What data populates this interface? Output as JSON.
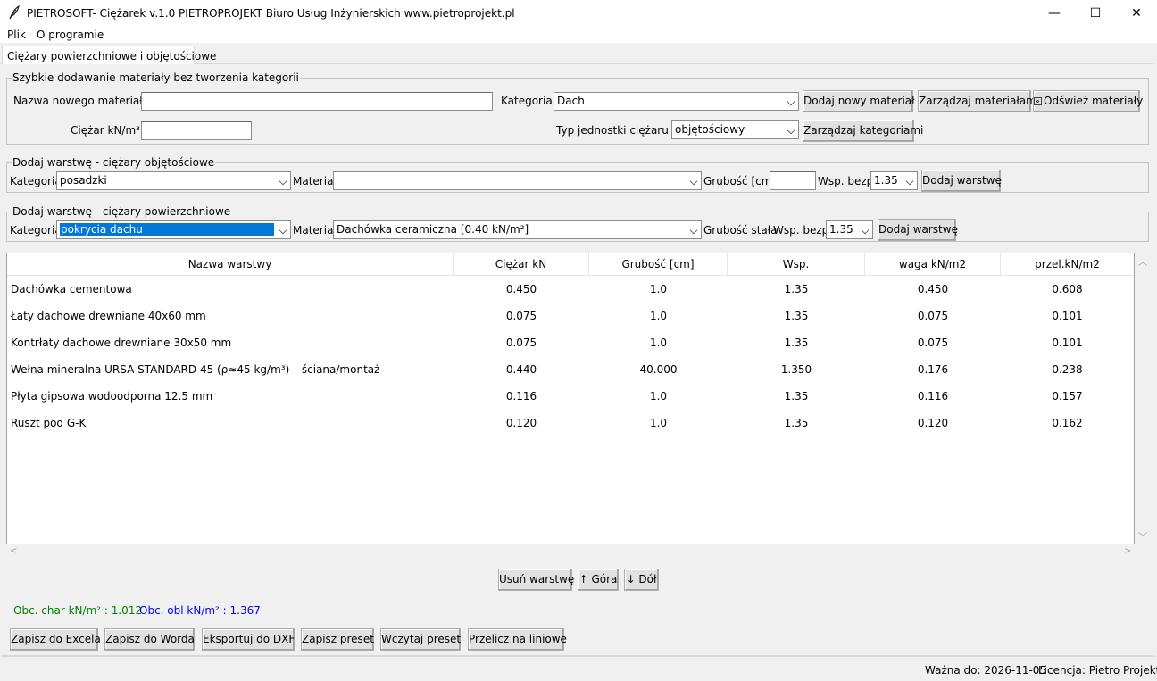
{
  "window": {
    "title": "PIETROSOFT- Ciężarek v.1.0 PIETROPROJEKT Biuro Usług Inżynierskich www.pietroprojekt.pl",
    "minimize": "—",
    "maximize": "☐",
    "close": "✕"
  },
  "menu": [
    "Plik",
    "O programie"
  ],
  "tab_label": "Ciężary powierzchniowe i objętościowe",
  "quick_add": {
    "legend": "Szybkie dodawanie materiały bez tworzenia kategorii",
    "name_label": "Nazwa nowego materiału",
    "name_value": "",
    "category_label": "Kategoria",
    "category_value": "Dach",
    "add_button": "Dodaj nowy materiał",
    "manage_materials_button": "Zarządzaj materiałami",
    "refresh_button": "Odśwież materiały",
    "weight_label": "Ciężar kN/m³",
    "weight_value": "",
    "unit_type_label": "Typ jednostki ciężaru",
    "unit_type_value": "objętościowy",
    "manage_categories_button": "Zarządzaj kategoriami"
  },
  "volume_layer": {
    "legend": "Dodaj warstwę - ciężary objętościowe",
    "category_label": "Kategoria",
    "category_value": "posadzki",
    "material_label": "Materiał",
    "material_value": "",
    "thickness_label": "Grubość [cm]",
    "thickness_value": "",
    "safety_label": "Wsp. bezp.",
    "safety_value": "1.35",
    "add_button": "Dodaj warstwę"
  },
  "surface_layer": {
    "legend": "Dodaj warstwę - ciężary powierzchniowe",
    "category_label": "Kategoria",
    "category_value": "pokrycia dachu",
    "material_label": "Materiał",
    "material_value": "Dachówka ceramiczna  [0.40 kN/m²]",
    "thickness_label": "Grubość  stała",
    "safety_label": "Wsp. bezp.",
    "safety_value": "1.35",
    "add_button": "Dodaj warstwę"
  },
  "table": {
    "columns": [
      "Nazwa warstwy",
      "Ciężar kN",
      "Grubość [cm]",
      "Wsp.",
      "waga kN/m2",
      "przel.kN/m2"
    ],
    "rows": [
      [
        "Dachówka cementowa",
        "0.450",
        "1.0",
        "1.35",
        "0.450",
        "0.608"
      ],
      [
        "Łaty dachowe drewniane 40x60 mm",
        "0.075",
        "1.0",
        "1.35",
        "0.075",
        "0.101"
      ],
      [
        "Kontrłaty dachowe drewniane 30x50 mm",
        "0.075",
        "1.0",
        "1.35",
        "0.075",
        "0.101"
      ],
      [
        "Wełna mineralna URSA STANDARD 45 (ρ≈45 kg/m³) – ściana/montaż",
        "0.440",
        "40.000",
        "1.350",
        "0.176",
        "0.238"
      ],
      [
        "Płyta gipsowa wodoodporna 12.5 mm",
        "0.116",
        "1.0",
        "1.35",
        "0.116",
        "0.157"
      ],
      [
        "Ruszt pod G-K",
        "0.120",
        "1.0",
        "1.35",
        "0.120",
        "0.162"
      ]
    ]
  },
  "row_actions": {
    "delete": "Usuń warstwę",
    "up": "↑ Góra",
    "down": "↓ Dół"
  },
  "totals": {
    "char": "Obc. char kN/m² : 1.012",
    "obl": "Obc. obl kN/m² : 1.367",
    "char_color": "#008000",
    "obl_color": "#0000ff"
  },
  "bottom_buttons": [
    "Zapisz do Excela",
    "Zapisz do Worda",
    "Eksportuj do DXF",
    "Zapisz preset",
    "Wczytaj preset",
    "Przelicz na liniowe"
  ],
  "status": {
    "valid_until": "Ważna do: 2026-11-05",
    "license": "Licencja: Pietro Projekt"
  }
}
